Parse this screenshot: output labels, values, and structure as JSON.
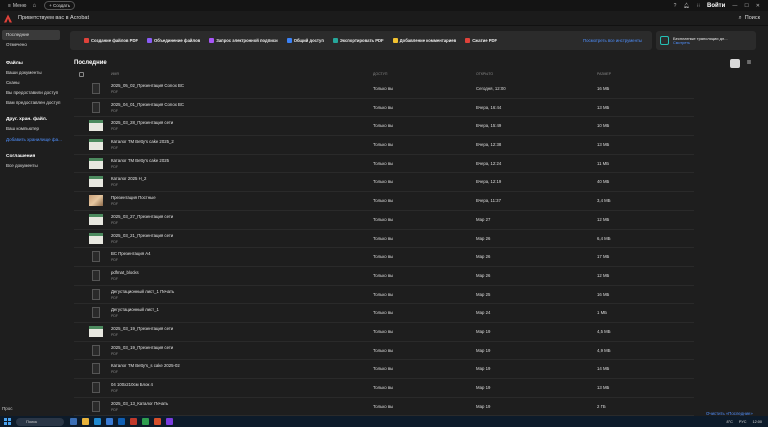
{
  "titlebar": {
    "menu_label": "Меню",
    "create_label": "+ Создать",
    "signin_label": "Войти"
  },
  "appbar": {
    "welcome": "Приветствуем вас в Acrobat",
    "search_label": "Поиск"
  },
  "sidebar": {
    "top_items": [
      "Последние",
      "Отмечено"
    ],
    "files_heading": "Файлы",
    "files_items": [
      "Ваши документы",
      "Сканы",
      "Вы предоставили доступ",
      "Вам предоставлен доступ"
    ],
    "other_heading": "Друг. хран. файл.",
    "other_items": [
      "Ваш компьютер"
    ],
    "add_storage": "Добавить хранилище фа...",
    "agreements_heading": "Соглашения",
    "agreements_items": [
      "Все документы"
    ],
    "footer": "Прос"
  },
  "tools": {
    "items": [
      {
        "label": "Создание файлов PDF",
        "color": "#e0423a"
      },
      {
        "label": "Объединение файлов",
        "color": "#8a5cf6"
      },
      {
        "label": "Запрос электронной подписи",
        "color": "#a855f7"
      },
      {
        "label": "Общий доступ",
        "color": "#3b82f6"
      },
      {
        "label": "Экспортировать PDF",
        "color": "#26a69a"
      },
      {
        "label": "Добавление комментариев",
        "color": "#f2c230"
      },
      {
        "label": "Сжатие PDF",
        "color": "#e0423a"
      }
    ],
    "see_all": "Посмотреть все инструменты"
  },
  "promo": {
    "title": "Бесплатные трансляции дл...",
    "link": "Смотреть"
  },
  "recent": {
    "title": "Последние",
    "columns": [
      "ИМЯ",
      "ДОСТУП",
      "ОТКРЫТО",
      "РАЗМЕР"
    ],
    "rows": [
      {
        "name": "2025_05_02_Презентация Conox BC",
        "type": "PDF",
        "access": "Только вы",
        "opened": "Сегодня, 12:00",
        "size": "16 МБ",
        "thumb": "pdf"
      },
      {
        "name": "2025_04_01_Презентация Conox BC",
        "type": "PDF",
        "access": "Только вы",
        "opened": "Вчера, 16:44",
        "size": "13 МБ",
        "thumb": "pdf"
      },
      {
        "name": "2025_03_28_Презентация сети",
        "type": "PDF",
        "access": "Только вы",
        "opened": "Вчера, 15:49",
        "size": "10 МБ",
        "thumb": "green"
      },
      {
        "name": "Каталог ТМ Betty's cake 2025_2",
        "type": "PDF",
        "access": "Только вы",
        "opened": "Вчера, 12:38",
        "size": "13 МБ",
        "thumb": "green"
      },
      {
        "name": "Каталог ТМ Betty's cake 2025",
        "type": "PDF",
        "access": "Только вы",
        "opened": "Вчера, 12:24",
        "size": "11 МБ",
        "thumb": "green"
      },
      {
        "name": "Каталог 2025 H_2",
        "type": "PDF",
        "access": "Только вы",
        "opened": "Вчера, 12:19",
        "size": "40 МБ",
        "thumb": "green"
      },
      {
        "name": "Презентация Постные",
        "type": "PDF",
        "access": "Только вы",
        "opened": "Вчера, 11:37",
        "size": "3,4 МБ",
        "thumb": "photo"
      },
      {
        "name": "2025_03_27_Презентация сети",
        "type": "PDF",
        "access": "Только вы",
        "opened": "Мар 27",
        "size": "12 МБ",
        "thumb": "green"
      },
      {
        "name": "2025_03_21_Презентация сети",
        "type": "PDF",
        "access": "Только вы",
        "opened": "Мар 26",
        "size": "6,4 МБ",
        "thumb": "green"
      },
      {
        "name": "BC Презентация А4",
        "type": "PDF",
        "access": "Только вы",
        "opened": "Мар 26",
        "size": "17 МБ",
        "thumb": "pdf"
      },
      {
        "name": "pdfmat_blocks",
        "type": "PDF",
        "access": "Только вы",
        "opened": "Мар 26",
        "size": "12 МБ",
        "thumb": "pdf"
      },
      {
        "name": "Дегустационный лист_1 Печать",
        "type": "PDF",
        "access": "Только вы",
        "opened": "Мар 25",
        "size": "16 МБ",
        "thumb": "pdf"
      },
      {
        "name": "Дегустационный лист_1",
        "type": "PDF",
        "access": "Только вы",
        "opened": "Мар 24",
        "size": "1 МБ",
        "thumb": "pdf"
      },
      {
        "name": "2025_03_19_Презентация сети",
        "type": "PDF",
        "access": "Только вы",
        "opened": "Мар 19",
        "size": "4,5 МБ",
        "thumb": "green"
      },
      {
        "name": "2025_03_19_Презентация сети",
        "type": "PDF",
        "access": "Только вы",
        "opened": "Мар 19",
        "size": "4,9 МБ",
        "thumb": "pdf"
      },
      {
        "name": "Каталог ТМ Betty's_s cake 2025-02",
        "type": "PDF",
        "access": "Только вы",
        "opened": "Мар 19",
        "size": "14 МБ",
        "thumb": "pdf"
      },
      {
        "name": "04 100х210см Блок 4",
        "type": "PDF",
        "access": "Только вы",
        "opened": "Мар 19",
        "size": "13 МБ",
        "thumb": "pdf"
      },
      {
        "name": "2025_03_13_Каталог Печать",
        "type": "PDF",
        "access": "Только вы",
        "opened": "Мар 19",
        "size": "2 ГБ",
        "thumb": "pdf"
      }
    ],
    "clear_link": "Очистить «Последние»"
  },
  "taskbar": {
    "search_placeholder": "Поиск",
    "weather": "8°C",
    "lang": "РУС",
    "time": "12:00"
  }
}
